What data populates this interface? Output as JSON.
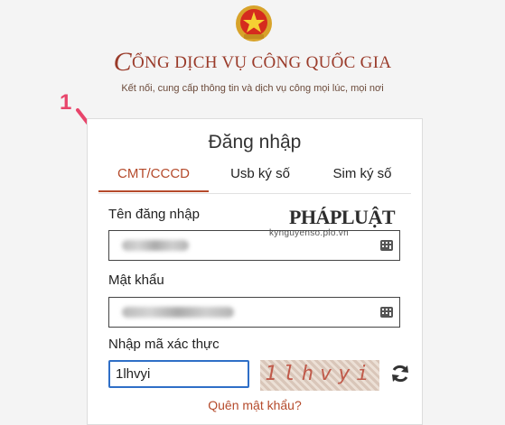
{
  "header": {
    "emblem_icon": "national-emblem-icon",
    "title_initial": "C",
    "title_rest": "ỔNG DỊCH VỤ CÔNG QUỐC GIA",
    "subtitle": "Kết nối, cung cấp thông tin và dịch vụ công mọi lúc, mọi nơi"
  },
  "annotation": {
    "number": "1",
    "color": "#e8456b"
  },
  "login": {
    "title": "Đăng nhập",
    "tabs": [
      {
        "label": "CMT/CCCD",
        "active": true
      },
      {
        "label": "Usb ký số",
        "active": false
      },
      {
        "label": "Sim ký số",
        "active": false
      }
    ],
    "username_label": "Tên đăng nhập",
    "password_label": "Mật khẩu",
    "captcha_label": "Nhập mã xác thực",
    "captcha_input_value": "1lhvyi",
    "captcha_image_text": "1lhvyi",
    "forgot_password": "Quên mật khẩu?",
    "accent_color": "#b54b2c"
  },
  "watermark": {
    "logo": "PHÁPLUẬT",
    "site": "kynguyenso.plo.vn"
  }
}
